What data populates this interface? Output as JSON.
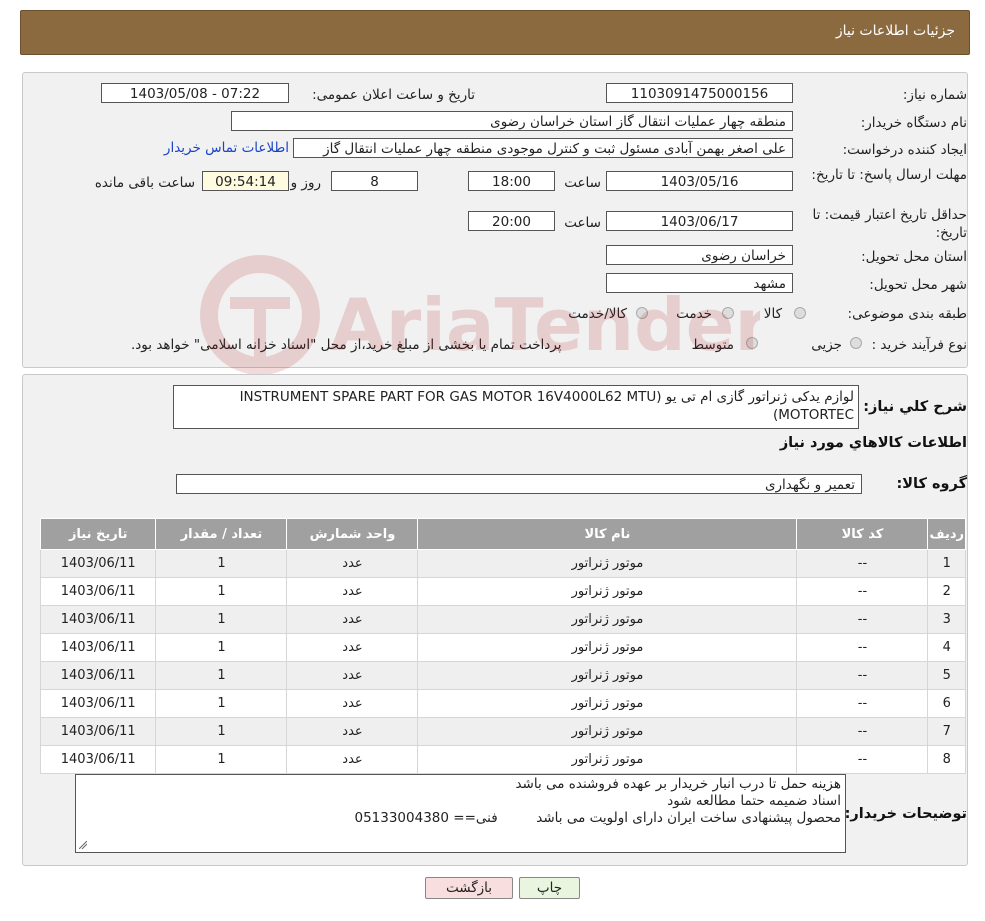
{
  "header": {
    "title": "جزئیات اطلاعات نیاز"
  },
  "form": {
    "need_number_label": "شماره نیاز:",
    "need_number": "1103091475000156",
    "announce_label": "تاریخ و ساعت اعلان عمومی:",
    "announce_value": "1403/05/08 - 07:22",
    "buyer_org_label": "نام دستگاه خریدار:",
    "buyer_org": "منطقه چهار عملیات انتقال گاز   استان خراسان رضوی",
    "creator_label": "ایجاد کننده درخواست:",
    "creator": "علی اصغر بهمن آبادی مسئول ثبت و کنترل موجودی منطقه چهار عملیات انتقال گاز",
    "contact_link": "اطلاعات تماس خریدار",
    "reply_deadline_label": "مهلت ارسال پاسخ: تا تاریخ:",
    "reply_date": "1403/05/16",
    "time_label": "ساعت",
    "reply_time": "18:00",
    "days": "8",
    "days_label": "روز و",
    "remaining_time": "09:54:14",
    "remaining_label": "ساعت باقی مانده",
    "price_validity_label": "حداقل تاریخ اعتبار قیمت: تا تاریخ:",
    "price_date": "1403/06/17",
    "price_time": "20:00",
    "province_label": "استان محل تحویل:",
    "province": "خراسان رضوی",
    "city_label": "شهر محل تحویل:",
    "city": "مشهد",
    "category_label": "طبقه بندی موضوعی:",
    "category_options": [
      "کالا",
      "خدمت",
      "کالا/خدمت"
    ],
    "process_label": "نوع فرآیند خرید :",
    "process_options": [
      "جزیی",
      "متوسط"
    ],
    "process_note": "پرداخت تمام یا بخشی از مبلغ خرید،از محل \"اسناد خزانه اسلامی\" خواهد بود."
  },
  "details": {
    "summary_label": "شرح کلي نياز:",
    "summary": "لوازم یدکی ژنراتور گازی ام تی یو   (INSTRUMENT SPARE PART FOR GAS MOTOR 16V4000L62  MTU MOTORTEC)",
    "goods_info_title": "اطلاعات کالاهاي مورد نياز",
    "group_label": "گروه کالا:",
    "group_value": "تعمیر و نگهداری",
    "table": {
      "headers": [
        "ردیف",
        "کد کالا",
        "نام کالا",
        "واحد شمارش",
        "تعداد / مقدار",
        "تاریخ نیاز"
      ],
      "rows": [
        [
          "1",
          "--",
          "موتور ژنراتور",
          "عدد",
          "1",
          "1403/06/11"
        ],
        [
          "2",
          "--",
          "موتور ژنراتور",
          "عدد",
          "1",
          "1403/06/11"
        ],
        [
          "3",
          "--",
          "موتور ژنراتور",
          "عدد",
          "1",
          "1403/06/11"
        ],
        [
          "4",
          "--",
          "موتور ژنراتور",
          "عدد",
          "1",
          "1403/06/11"
        ],
        [
          "5",
          "--",
          "موتور ژنراتور",
          "عدد",
          "1",
          "1403/06/11"
        ],
        [
          "6",
          "--",
          "موتور ژنراتور",
          "عدد",
          "1",
          "1403/06/11"
        ],
        [
          "7",
          "--",
          "موتور ژنراتور",
          "عدد",
          "1",
          "1403/06/11"
        ],
        [
          "8",
          "--",
          "موتور ژنراتور",
          "عدد",
          "1",
          "1403/06/11"
        ]
      ]
    },
    "notes_label": "توضیحات خریدار:",
    "notes": [
      "هزینه حمل تا درب انبار خریدار بر عهده فروشنده می باشد",
      "اسناد ضمیمه حتما مطالعه شود",
      "محصول پیشنهادی ساخت ایران دارای اولویت می باشد         فنی== 05133004380"
    ]
  },
  "buttons": {
    "print": "چاپ",
    "back": "بازگشت"
  },
  "watermark": {
    "text": "AriaTender.neT"
  }
}
